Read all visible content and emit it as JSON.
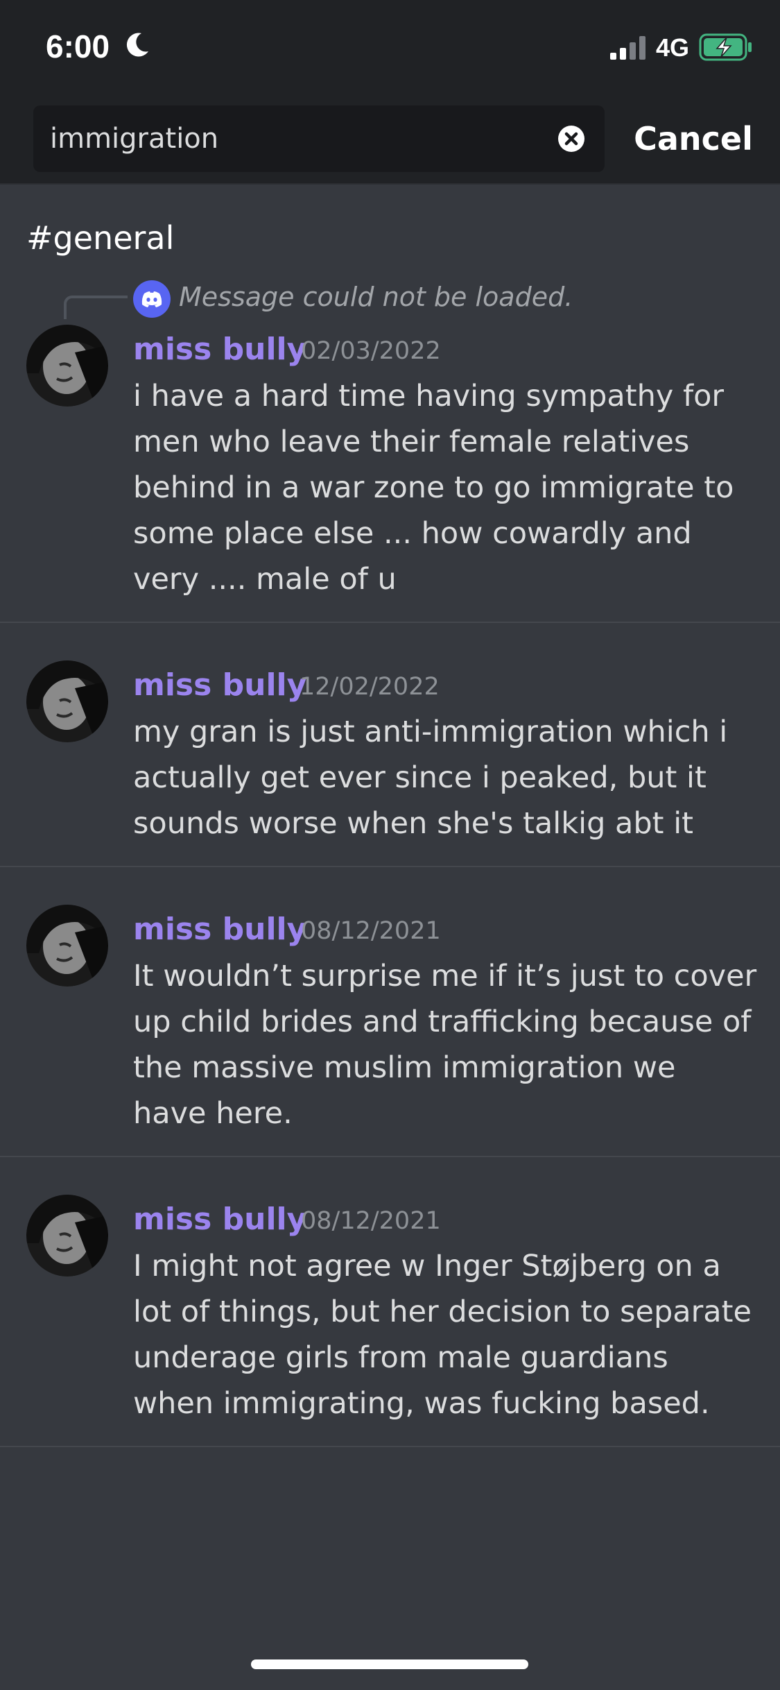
{
  "status_bar": {
    "time": "6:00",
    "network": "4G",
    "battery_color": "#43b581"
  },
  "search": {
    "query": "immigration",
    "cancel_label": "Cancel"
  },
  "channel": {
    "name": "#general"
  },
  "reply_reference": {
    "text": "Message could not be loaded.",
    "icon": "discord-icon"
  },
  "messages": [
    {
      "author": "miss bully",
      "date": "02/03/2022",
      "text": "i have a hard time having sympathy for men who leave their female relatives behind in a war zone to go immigrate to some place else ... how cowardly and very .... male of u"
    },
    {
      "author": "miss bully",
      "date": "12/02/2022",
      "text": "my gran is just anti-immigration which i actually get ever since i peaked, but it sounds worse when she's talkig abt it"
    },
    {
      "author": "miss bully",
      "date": "08/12/2021",
      "text": "It wouldn’t surprise me if it’s just to cover up child brides and trafficking because of the massive muslim immigration we have here."
    },
    {
      "author": "miss bully",
      "date": "08/12/2021",
      "text": "I might not agree w Inger Støjberg on a lot of things, but her decision to separate underage girls from male guardians when immigrating, was fucking based."
    }
  ],
  "colors": {
    "background": "#36393f",
    "header": "#202225",
    "author": "#9b84ee",
    "discord_blurple": "#5865f2"
  }
}
